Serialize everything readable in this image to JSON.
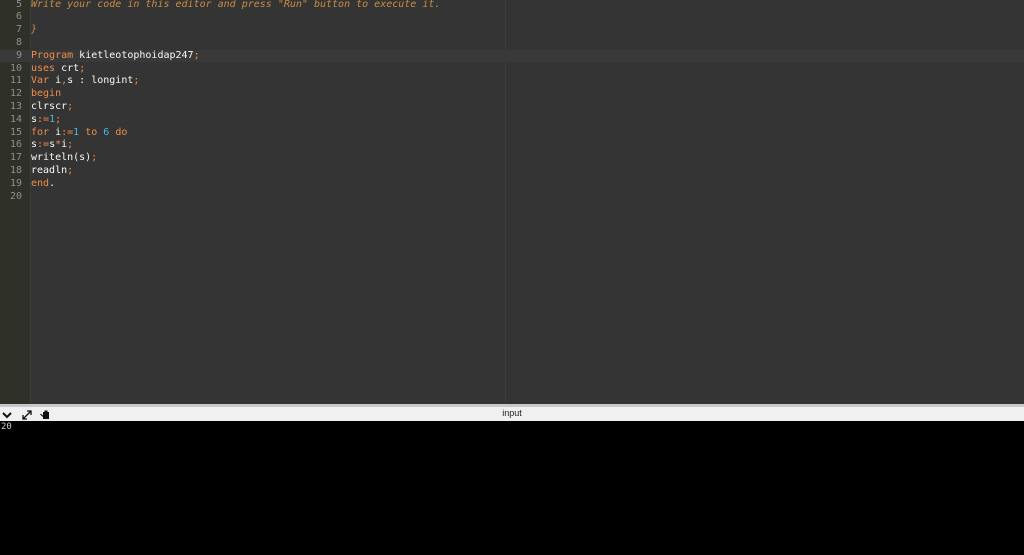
{
  "editor": {
    "lines": [
      {
        "n": "5",
        "tokens": [
          {
            "t": "Write your code in this editor and press \"Run\" button to execute it.",
            "c": "comment"
          }
        ]
      },
      {
        "n": "6",
        "tokens": []
      },
      {
        "n": "7",
        "tokens": [
          {
            "t": "}",
            "c": "comment"
          }
        ]
      },
      {
        "n": "8",
        "tokens": []
      },
      {
        "n": "9",
        "active": true,
        "tokens": [
          {
            "t": "Program",
            "c": "kw"
          },
          {
            "t": " kietleotophoidap247",
            "c": "id"
          },
          {
            "t": ";",
            "c": "punct"
          }
        ]
      },
      {
        "n": "10",
        "tokens": [
          {
            "t": "uses",
            "c": "kw"
          },
          {
            "t": " crt",
            "c": "id"
          },
          {
            "t": ";",
            "c": "punct"
          }
        ]
      },
      {
        "n": "11",
        "tokens": [
          {
            "t": "Var",
            "c": "kw"
          },
          {
            "t": " i",
            "c": "id"
          },
          {
            "t": ",",
            "c": "punct"
          },
          {
            "t": "s : longint",
            "c": "id"
          },
          {
            "t": ";",
            "c": "punct"
          }
        ]
      },
      {
        "n": "12",
        "tokens": [
          {
            "t": "begin",
            "c": "kw"
          }
        ]
      },
      {
        "n": "13",
        "tokens": [
          {
            "t": "clrscr",
            "c": "id"
          },
          {
            "t": ";",
            "c": "punct"
          }
        ]
      },
      {
        "n": "14",
        "tokens": [
          {
            "t": "s",
            "c": "id"
          },
          {
            "t": ":=",
            "c": "op"
          },
          {
            "t": "1",
            "c": "num"
          },
          {
            "t": ";",
            "c": "punct"
          }
        ]
      },
      {
        "n": "15",
        "tokens": [
          {
            "t": "for",
            "c": "kw"
          },
          {
            "t": " i",
            "c": "id"
          },
          {
            "t": ":=",
            "c": "op"
          },
          {
            "t": "1",
            "c": "num"
          },
          {
            "t": " ",
            "c": "id"
          },
          {
            "t": "to",
            "c": "kw"
          },
          {
            "t": " ",
            "c": "id"
          },
          {
            "t": "6",
            "c": "num"
          },
          {
            "t": " ",
            "c": "id"
          },
          {
            "t": "do",
            "c": "kw"
          }
        ]
      },
      {
        "n": "16",
        "tokens": [
          {
            "t": "s",
            "c": "id"
          },
          {
            "t": ":=",
            "c": "op"
          },
          {
            "t": "s",
            "c": "id"
          },
          {
            "t": "*",
            "c": "op"
          },
          {
            "t": "i",
            "c": "id"
          },
          {
            "t": ";",
            "c": "punct"
          }
        ]
      },
      {
        "n": "17",
        "tokens": [
          {
            "t": "writeln(s)",
            "c": "id"
          },
          {
            "t": ";",
            "c": "punct"
          }
        ]
      },
      {
        "n": "18",
        "tokens": [
          {
            "t": "readln",
            "c": "id"
          },
          {
            "t": ";",
            "c": "punct"
          }
        ]
      },
      {
        "n": "19",
        "tokens": [
          {
            "t": "end",
            "c": "kw"
          },
          {
            "t": ".",
            "c": "id"
          }
        ]
      },
      {
        "n": "20",
        "tokens": []
      }
    ]
  },
  "console": {
    "title": "input",
    "output": "20",
    "icons": [
      "chevron-down-icon",
      "expand-icon",
      "clear-console-icon"
    ]
  },
  "colors": {
    "editor_bg": "#343434",
    "gutter_bg": "#2f3129",
    "keyword": "#f08d49",
    "number": "#4cb5e5",
    "comment": "#c98d44",
    "text": "#f8f8f2"
  }
}
